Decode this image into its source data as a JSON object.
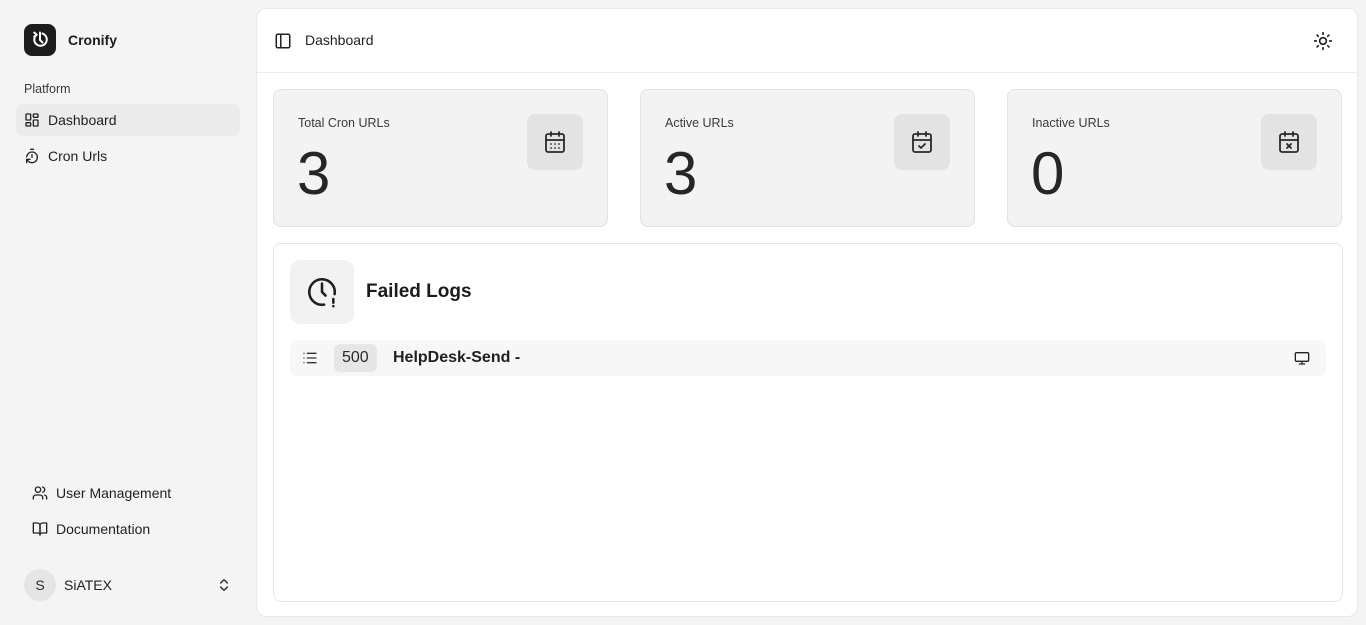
{
  "app": {
    "name": "Cronify"
  },
  "sidebar": {
    "section_label": "Platform",
    "items": [
      {
        "label": "Dashboard",
        "icon": "dashboard-grid-icon",
        "active": true
      },
      {
        "label": "Cron Urls",
        "icon": "timer-reset-icon",
        "active": false
      }
    ],
    "footer_items": [
      {
        "label": "User Management",
        "icon": "users-icon"
      },
      {
        "label": "Documentation",
        "icon": "book-open-icon"
      }
    ],
    "user": {
      "initial": "S",
      "name": "SiATEX"
    }
  },
  "header": {
    "breadcrumb": "Dashboard"
  },
  "stats": [
    {
      "label": "Total Cron URLs",
      "value": "3",
      "icon": "calendar-grid-icon"
    },
    {
      "label": "Active URLs",
      "value": "3",
      "icon": "calendar-check-icon"
    },
    {
      "label": "Inactive URLs",
      "value": "0",
      "icon": "calendar-x-icon"
    }
  ],
  "failed_logs": {
    "title": "Failed Logs",
    "rows": [
      {
        "code": "500",
        "name": "HelpDesk-Send -"
      }
    ]
  }
}
